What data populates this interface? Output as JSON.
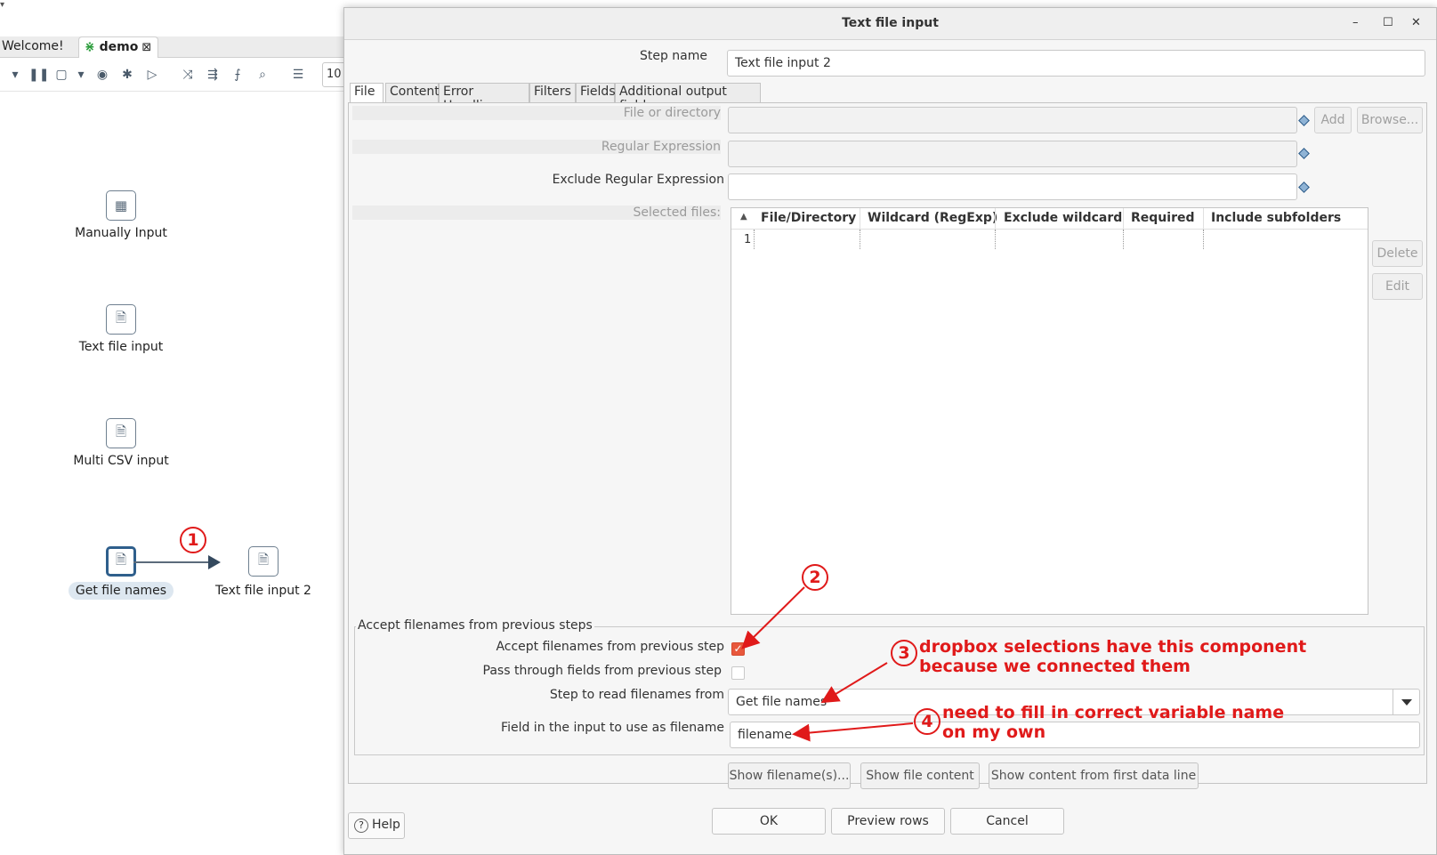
{
  "editor": {
    "tabs": [
      {
        "label": "Welcome!"
      },
      {
        "label": "demo"
      }
    ],
    "toolbar_value": "10",
    "nodes": [
      {
        "label": "Manually Input"
      },
      {
        "label": "Text file input"
      },
      {
        "label": "Multi CSV input"
      },
      {
        "label": "Get file names"
      },
      {
        "label": "Text file input 2"
      }
    ]
  },
  "dialog": {
    "title": "Text file input",
    "step_name_label": "Step name",
    "step_name_value": "Text file input 2",
    "tabs": [
      "File",
      "Content",
      "Error Handling",
      "Filters",
      "Fields",
      "Additional output fields"
    ],
    "file_or_directory_label": "File or directory",
    "regex_label": "Regular Expression",
    "exclude_regex_label": "Exclude Regular Expression",
    "selected_files_label": "Selected files:",
    "add_button": "Add",
    "browse_button": "Browse...",
    "delete_button": "Delete",
    "edit_button": "Edit",
    "table": {
      "columns": [
        "File/Directory",
        "Wildcard (RegExp)",
        "Exclude wildcard",
        "Required",
        "Include subfolders"
      ],
      "rows": [
        {
          "num": "1"
        }
      ]
    },
    "group_title": "Accept filenames from previous steps",
    "accept_label": "Accept filenames from previous step",
    "accept_checked": true,
    "pass_through_label": "Pass through fields from previous step",
    "pass_through_checked": false,
    "step_read_label": "Step to read filenames from",
    "step_read_value": "Get file names",
    "field_label": "Field in the input to use as filename",
    "field_value": "filename",
    "show_filenames_button": "Show filename(s)...",
    "show_file_content_button": "Show file content",
    "show_content_first_button": "Show content from first data line",
    "help_button": "Help",
    "ok_button": "OK",
    "preview_button": "Preview rows",
    "cancel_button": "Cancel"
  },
  "annotations": {
    "n1": "1",
    "n2": "2",
    "n3": "3",
    "n4": "4",
    "text3_line1": "dropbox selections have this component",
    "text3_line2": "because we connected them",
    "text4_line1": "need to fill in correct variable name",
    "text4_line2": "on my own",
    "color": "#e01a1a"
  }
}
